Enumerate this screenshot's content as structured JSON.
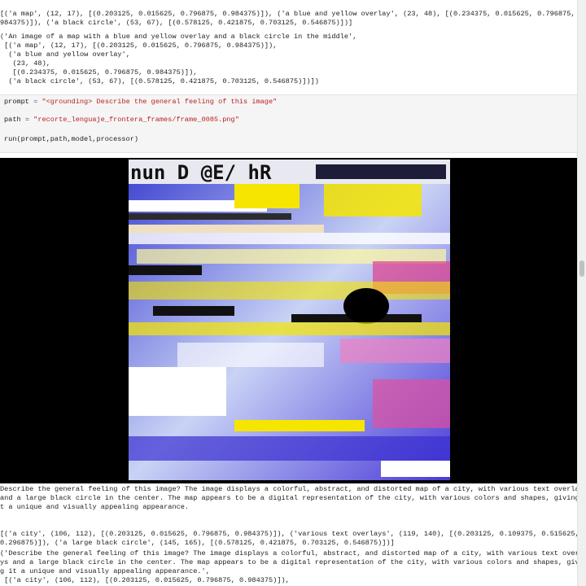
{
  "output_top": {
    "line1": "[('a map', (12, 17), [(0.203125, 0.015625, 0.796875, 0.984375)]), ('a blue and yellow overlay', (23, 48), [(0.234375, 0.015625, 0.796875, 0.",
    "line2": "984375)]), ('a black circle', (53, 67), [(0.578125, 0.421875, 0.703125, 0.546875)])]",
    "line3": "('An image of a map with a blue and yellow overlay and a black circle in the middle',",
    "line4": " [('a map', (12, 17), [(0.203125, 0.015625, 0.796875, 0.984375)]),",
    "line5": "  ('a blue and yellow overlay',",
    "line6": "   (23, 48),",
    "line7": "   [(0.234375, 0.015625, 0.796875, 0.984375)]),",
    "line8": "  ('a black circle', (53, 67), [(0.578125, 0.421875, 0.703125, 0.546875)])])"
  },
  "cell": {
    "prompt_var": "prompt",
    "eq": "=",
    "prompt_value": "\"<grounding> Describe the general feeling of this image\"",
    "path_var": "path",
    "path_value": "\"recorte_lenguaje_frontera_frames/frame_0085.png\"",
    "call": "run(prompt,path,model,processor)"
  },
  "image": {
    "header_text": "nun D @E/ hR"
  },
  "description": {
    "line1": "Describe the general feeling of this image? The image displays a colorful, abstract, and distorted map of a city, with various text overlays",
    "line2": "and a large black circle in the center. The map appears to be a digital representation of the city, with various colors and shapes, giving i",
    "line3": "t a unique and visually appealing appearance."
  },
  "entities": {
    "line1": "[('a city', (106, 112), [(0.203125, 0.015625, 0.796875, 0.984375)]), ('various text overlays', (119, 140), [(0.203125, 0.109375, 0.515625,",
    "line2": "0.296875)]), ('a large black circle', (145, 165), [(0.578125, 0.421875, 0.703125, 0.546875)])]"
  },
  "tuple_out": {
    "line1": "('Describe the general feeling of this image? The image displays a colorful, abstract, and distorted map of a city, with various text overla",
    "line2": "ys and a large black circle in the center. The map appears to be a digital representation of the city, with various colors and shapes, givin",
    "line3": "g it a unique and visually appealing appearance.',",
    "line4": " [('a city', (106, 112), [(0.203125, 0.015625, 0.796875, 0.984375)]),"
  },
  "colors": {
    "string": "#ba2121",
    "operator": "#7a4aa8",
    "cell_bg": "#f5f5f5"
  }
}
